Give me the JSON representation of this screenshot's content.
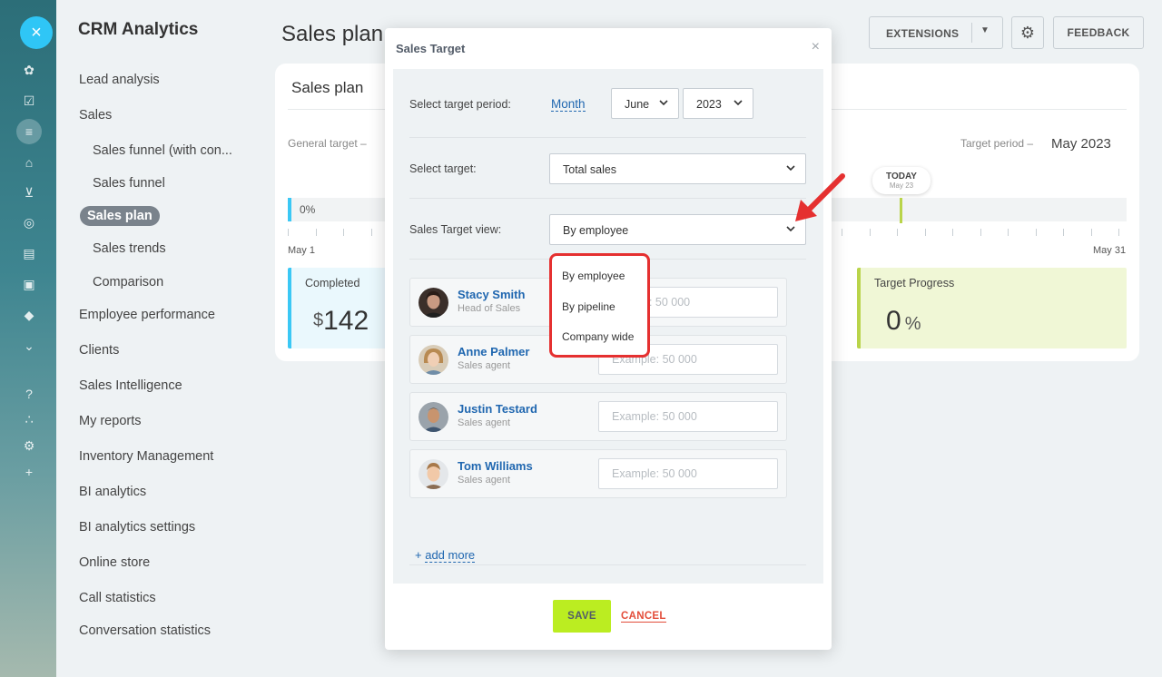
{
  "rail": {
    "close": "×",
    "icons": [
      "analytics-icon",
      "tasks-icon",
      "filter-icon",
      "store-icon",
      "cart-icon",
      "target-icon",
      "contact-card-icon",
      "robot-icon",
      "box-icon",
      "chevron-down-circle-icon",
      "help-icon",
      "sitemap-icon",
      "gear-icon",
      "plus-icon"
    ]
  },
  "menu": {
    "title": "CRM Analytics",
    "items": [
      {
        "label": "Lead analysis"
      },
      {
        "label": "Sales"
      },
      {
        "label": "Sales funnel (with con..."
      },
      {
        "label": "Sales funnel"
      },
      {
        "label": "Sales plan"
      },
      {
        "label": "Sales trends"
      },
      {
        "label": "Comparison"
      },
      {
        "label": "Employee performance"
      },
      {
        "label": "Clients"
      },
      {
        "label": "Sales Intelligence"
      },
      {
        "label": "My reports"
      },
      {
        "label": "Inventory Management"
      },
      {
        "label": "BI analytics"
      },
      {
        "label": "BI analytics settings"
      },
      {
        "label": "Online store"
      },
      {
        "label": "Call statistics"
      },
      {
        "label": "Conversation statistics"
      }
    ]
  },
  "header": {
    "title": "Sales plan",
    "extensions": "EXTENSIONS",
    "feedback": "FEEDBACK"
  },
  "card": {
    "title": "Sales plan",
    "general_target": "General target –",
    "target_period_label": "Target period –",
    "target_period_value": "May 2023",
    "today": "TODAY",
    "today_date": "May 23",
    "progress_pct": "0%",
    "start_label": "May 1",
    "end_label": "May 31",
    "completed_label": "Completed",
    "completed_currency": "$",
    "completed_value": "142",
    "progress_label": "Target Progress",
    "progress_value": "0",
    "progress_unit": "%"
  },
  "modal": {
    "title": "Sales Target",
    "close": "×",
    "period_label": "Select target period:",
    "period_type": "Month",
    "month": "June",
    "year": "2023",
    "target_label": "Select target:",
    "target_value": "Total sales",
    "view_label": "Sales Target view:",
    "view_value": "By employee",
    "employees": [
      {
        "name": "Stacy Smith",
        "role": "Head of Sales",
        "placeholder": "Example: 50 000",
        "visible_placeholder": "e: 50 000"
      },
      {
        "name": "Anne Palmer",
        "role": "Sales agent",
        "placeholder": "Example: 50 000",
        "visible_placeholder": "Example: 50 000"
      },
      {
        "name": "Justin Testard",
        "role": "Sales agent",
        "placeholder": "Example: 50 000",
        "visible_placeholder": "Example: 50 000"
      },
      {
        "name": "Tom Williams",
        "role": "Sales agent",
        "placeholder": "Example: 50 000",
        "visible_placeholder": "Example: 50 000"
      }
    ],
    "add_more": "add more",
    "save": "SAVE",
    "cancel": "CANCEL"
  },
  "dropdown": {
    "options": [
      "By employee",
      "By pipeline",
      "Company wide"
    ]
  },
  "colors": {
    "accent_blue": "#2fc6f6",
    "link": "#2067b0",
    "save_green": "#bbed21",
    "cancel_red": "#e34d3a",
    "highlight_red": "#e53030"
  }
}
